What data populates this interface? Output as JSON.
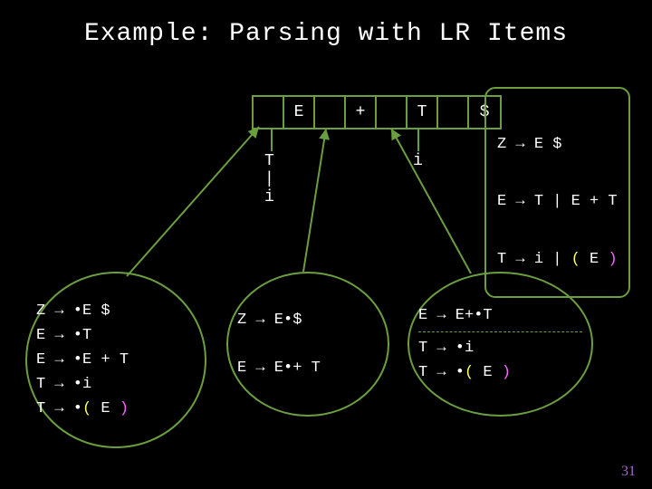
{
  "title": "Example: Parsing with LR Items",
  "stack": {
    "cells": [
      "",
      "E",
      "",
      "+",
      "",
      "T",
      "",
      "$"
    ]
  },
  "tree_left": "T\n|\ni",
  "tree_right": "i",
  "grammar": {
    "l1": {
      "lhs": "Z",
      "arr": "→",
      "rhs": "E $"
    },
    "l2": {
      "lhs": "E",
      "arr": "→",
      "rhs": "T | E + T"
    },
    "l3": {
      "lhs": "T",
      "arr": "→",
      "rhs_head": "i | ",
      "lp": "(",
      "mid": " E ",
      "rp": ")"
    }
  },
  "set1": {
    "l1": "Z → •E $",
    "l2": "E → •T",
    "l3": "E → •E + T",
    "l4": "T → •i",
    "l5_head": "T → •",
    "l5_lp": "(",
    "l5_mid": " E ",
    "l5_rp": ")"
  },
  "set2": {
    "l1": "Z → E•$",
    "l2": "E → E•+ T"
  },
  "set3": {
    "l1": "E → E+•T",
    "l2": "T → •i",
    "l3_head": "T → •",
    "l3_lp": "(",
    "l3_mid": " E ",
    "l3_rp": ")"
  },
  "page": "31"
}
